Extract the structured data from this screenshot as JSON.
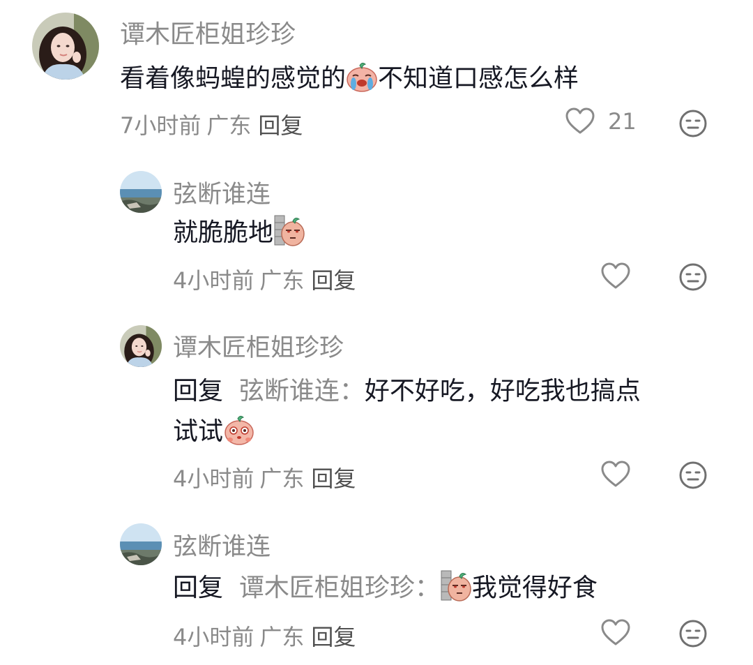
{
  "comments": [
    {
      "author": "谭木匠柜姐珍珍",
      "text_before": "看着像蚂蝗的感觉的",
      "sticker": "crying-potato-sticker",
      "text_after": "不知道口感怎么样",
      "time": "7小时前",
      "location": "广东",
      "reply_label": "回复",
      "likes": "21",
      "avatar": "woman-portrait-avatar"
    },
    {
      "author": "弦断谁连",
      "text_before": "就脆脆地",
      "sticker": "peeking-wall-potato-sticker",
      "time": "4小时前",
      "location": "广东",
      "reply_label": "回复",
      "avatar": "sea-landscape-avatar"
    },
    {
      "author": "谭木匠柜姐珍珍",
      "reply_prefix": "回复",
      "reply_to": "弦断谁连：",
      "text_line1": "好不好吃，好吃我也搞点",
      "text_line2": "试试",
      "sticker": "curious-potato-sticker",
      "time": "4小时前",
      "location": "广东",
      "reply_label": "回复",
      "avatar": "woman-portrait-avatar"
    },
    {
      "author": "弦断谁连",
      "reply_prefix": "回复",
      "reply_to": "谭木匠柜姐珍珍：",
      "sticker": "peeking-wall-potato-sticker",
      "text_after": "我觉得好食",
      "time": "4小时前",
      "location": "广东",
      "reply_label": "回复",
      "avatar": "sea-landscape-avatar"
    }
  ],
  "colors": {
    "meta_gray": "#8a8a8a",
    "text_dark": "#161823",
    "reply_gray": "#505050"
  },
  "icons": {
    "like": "heart-outline-icon",
    "dislike": "neutral-face-icon"
  }
}
